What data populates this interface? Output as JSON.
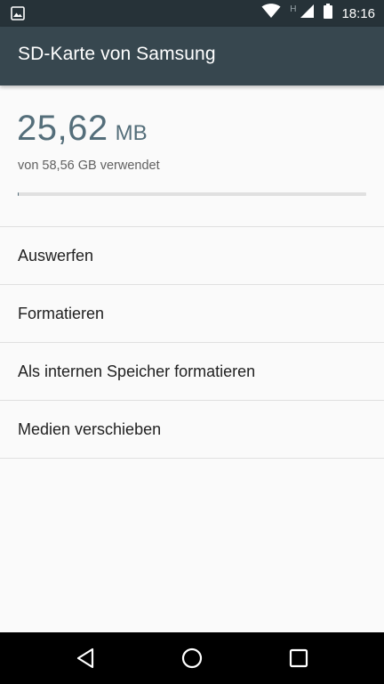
{
  "status_bar": {
    "time": "18:16",
    "network_type": "H",
    "icons": [
      "image-notification-icon",
      "wifi-icon",
      "cell-signal-icon",
      "battery-icon"
    ]
  },
  "app_bar": {
    "title": "SD-Karte von Samsung"
  },
  "storage": {
    "used_value": "25,62",
    "used_unit": "MB",
    "total_text": "von 58,56 GB verwendet",
    "used_fraction": 0.0004
  },
  "menu": {
    "items": [
      {
        "label": "Auswerfen"
      },
      {
        "label": "Formatieren"
      },
      {
        "label": "Als internen Speicher formatieren"
      },
      {
        "label": "Medien verschieben"
      }
    ]
  },
  "navigation": {
    "icons": [
      "back-icon",
      "home-icon",
      "recents-icon"
    ]
  },
  "colors": {
    "status_bar": "#263238",
    "app_bar": "#37474f",
    "accent": "#546e7a",
    "background": "#fafafa"
  }
}
